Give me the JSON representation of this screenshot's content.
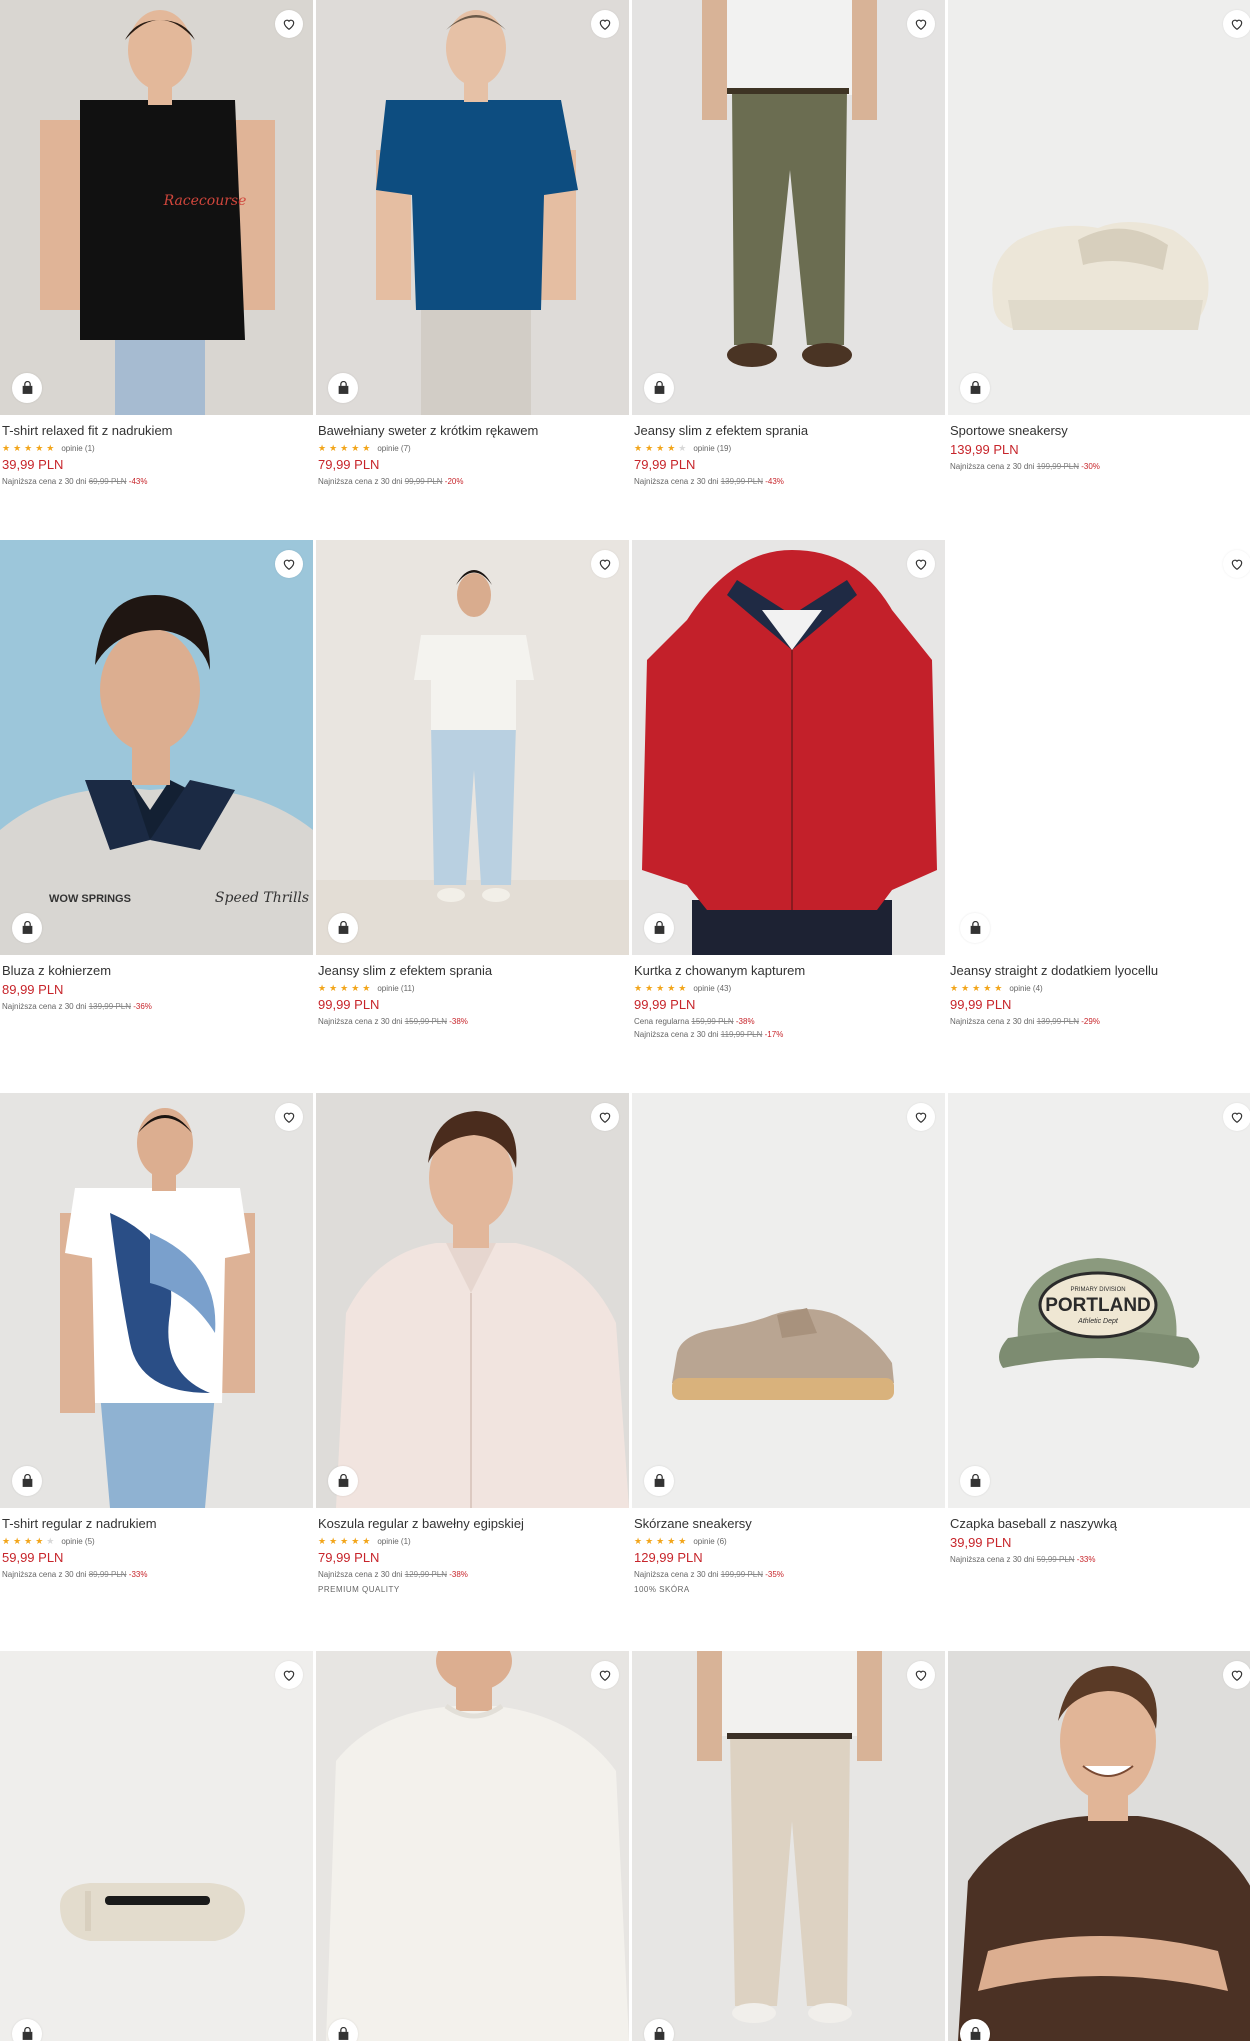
{
  "colors": {
    "accent": "#c7252b",
    "star": "#f2a51a",
    "text": "#333333"
  },
  "icons": {
    "favorite": "heart-outline-icon",
    "cart": "shopping-bag-icon",
    "rating": "star-icon"
  },
  "products": [
    {
      "name": "T-shirt relaxed fit z nadrukiem",
      "rating": 5,
      "reviews": "opinie (1)",
      "price": "39,99 PLN",
      "lowest_label": "Najniższa cena z 30 dni",
      "old_price": "69,99 PLN",
      "discount": "-43%"
    },
    {
      "name": "Bawełniany sweter z krótkim rękawem",
      "rating": 5,
      "reviews": "opinie (7)",
      "price": "79,99 PLN",
      "lowest_label": "Najniższa cena z 30 dni",
      "old_price": "99,99 PLN",
      "discount": "-20%"
    },
    {
      "name": "Jeansy slim z efektem sprania",
      "rating": 4.5,
      "reviews": "opinie (19)",
      "price": "79,99 PLN",
      "lowest_label": "Najniższa cena z 30 dni",
      "old_price": "139,99 PLN",
      "discount": "-43%"
    },
    {
      "name": "Sportowe sneakersy",
      "price": "139,99 PLN",
      "lowest_label": "Najniższa cena z 30 dni",
      "old_price": "199,99 PLN",
      "discount": "-30%"
    },
    {
      "name": "Bluza z kołnierzem",
      "price": "89,99 PLN",
      "lowest_label": "Najniższa cena z 30 dni",
      "old_price": "139,99 PLN",
      "discount": "-36%"
    },
    {
      "name": "Jeansy slim z efektem sprania",
      "rating": 5,
      "reviews": "opinie (11)",
      "price": "99,99 PLN",
      "lowest_label": "Najniższa cena z 30 dni",
      "old_price": "159,99 PLN",
      "discount": "-38%"
    },
    {
      "name": "Kurtka z chowanym kapturem",
      "rating": 5,
      "reviews": "opinie (43)",
      "price": "99,99 PLN",
      "regular_label": "Cena regularna",
      "regular_price": "159,99 PLN",
      "regular_discount": "-38%",
      "lowest_label": "Najniższa cena z 30 dni",
      "old_price": "119,99 PLN",
      "discount": "-17%"
    },
    {
      "name": "Jeansy straight z dodatkiem lyocellu",
      "rating": 5,
      "reviews": "opinie (4)",
      "price": "99,99 PLN",
      "lowest_label": "Najniższa cena z 30 dni",
      "old_price": "139,99 PLN",
      "discount": "-29%"
    },
    {
      "name": "T-shirt regular z nadrukiem",
      "rating": 4,
      "reviews": "opinie (5)",
      "price": "59,99 PLN",
      "lowest_label": "Najniższa cena z 30 dni",
      "old_price": "89,99 PLN",
      "discount": "-33%"
    },
    {
      "name": "Koszula regular z bawełny egipskiej",
      "rating": 5,
      "reviews": "opinie (1)",
      "price": "79,99 PLN",
      "lowest_label": "Najniższa cena z 30 dni",
      "old_price": "129,99 PLN",
      "discount": "-38%",
      "extra": "PREMIUM QUALITY"
    },
    {
      "name": "Skórzane sneakersy",
      "rating": 5,
      "reviews": "opinie (6)",
      "price": "129,99 PLN",
      "lowest_label": "Najniższa cena z 30 dni",
      "old_price": "199,99 PLN",
      "discount": "-35%",
      "extra": "100% SKÓRA"
    },
    {
      "name": "Czapka baseball z naszywką",
      "price": "39,99 PLN",
      "lowest_label": "Najniższa cena z 30 dni",
      "old_price": "59,99 PLN",
      "discount": "-33%"
    },
    {
      "name": ""
    },
    {
      "name": ""
    },
    {
      "name": ""
    },
    {
      "name": ""
    }
  ],
  "artwork": {
    "tee_print": "Racecourse",
    "polo_left": "WOW SPRINGS",
    "polo_right": "Speed Thrills",
    "cap_top": "PRIMARY DIVISION",
    "cap_main": "PORTLAND",
    "cap_bottom": "Athletic Dept"
  }
}
